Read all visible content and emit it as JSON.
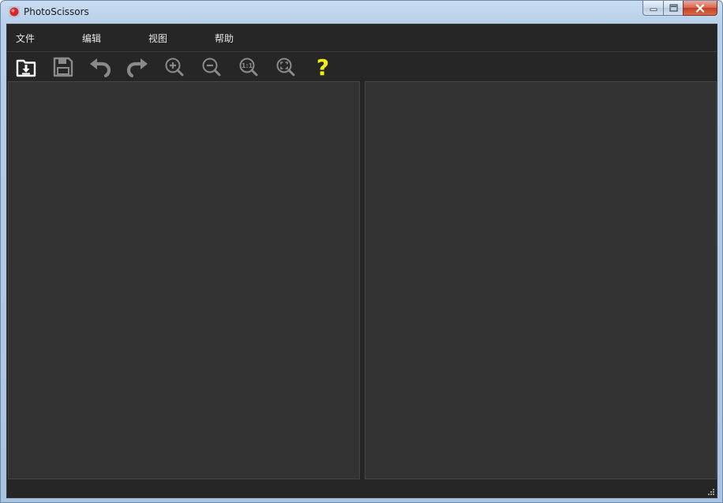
{
  "window": {
    "title": "PhotoScissors",
    "controls": [
      "minimize-icon",
      "maximize-icon",
      "close-icon"
    ]
  },
  "menu": {
    "items": [
      {
        "label": "文件"
      },
      {
        "label": "编辑"
      },
      {
        "label": "视图"
      },
      {
        "label": "帮助"
      }
    ]
  },
  "toolbar": {
    "tools": [
      {
        "icon": "open-file-icon"
      },
      {
        "icon": "save-icon"
      },
      {
        "icon": "undo-icon"
      },
      {
        "icon": "redo-icon"
      },
      {
        "icon": "zoom-in-icon"
      },
      {
        "icon": "zoom-out-icon"
      },
      {
        "icon": "actual-size-icon",
        "text": "1:1"
      },
      {
        "icon": "fit-to-window-icon"
      },
      {
        "icon": "help-icon",
        "text": "?"
      }
    ]
  },
  "colors": {
    "background": "#252525",
    "pane": "#323232",
    "icon_active": "#ffffff",
    "icon_disabled": "#8a8a8a",
    "help": "#f6ee12"
  }
}
